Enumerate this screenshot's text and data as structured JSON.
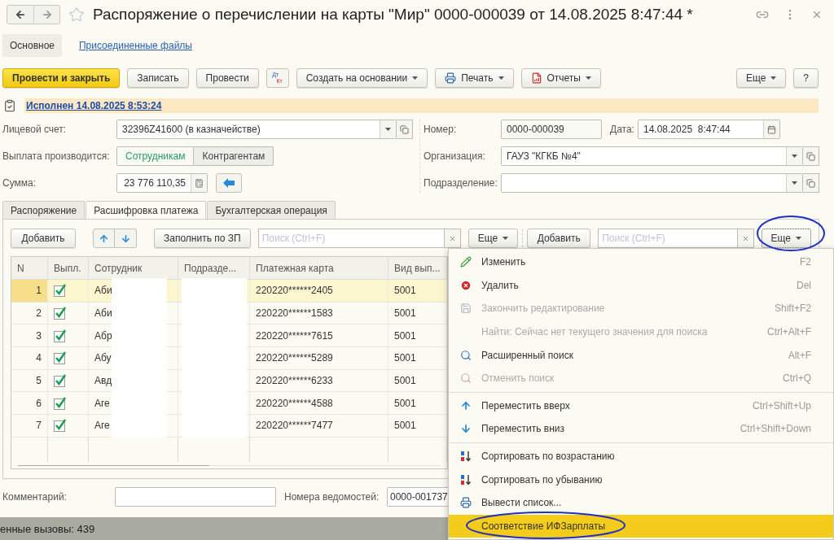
{
  "window": {
    "title": "Распоряжение о перечислении на карты \"Мир\" 0000-000039 от 14.08.2025 8:47:44 *",
    "starred": false
  },
  "form_tabs": [
    {
      "label": "Основное",
      "selected": true
    },
    {
      "label": "Присоединенные файлы",
      "selected": false
    }
  ],
  "command_bar": [
    {
      "label": "Провести и закрыть",
      "kind": "primary"
    },
    {
      "label": "Записать",
      "kind": "button"
    },
    {
      "label": "Провести",
      "kind": "button"
    },
    {
      "kind": "dtkt",
      "top": "Дт",
      "bottom": "Кт"
    },
    {
      "label": "Создать на основании",
      "kind": "dropdown"
    },
    {
      "label": "Печать",
      "kind": "print"
    },
    {
      "label": "Отчеты",
      "kind": "report"
    }
  ],
  "command_bar_right": [
    {
      "label": "Еще",
      "kind": "dropdown"
    },
    {
      "label": "?",
      "kind": "button"
    }
  ],
  "status": {
    "text": "Исполнен 14.08.2025 8:53:24"
  },
  "account": {
    "label": "Лицевой счет:",
    "value": "32396Z41600 (в казначействе)"
  },
  "payment_to": {
    "label": "Выплата производится:",
    "options": [
      {
        "label": "Сотрудникам",
        "selected": true
      },
      {
        "label": "Контрагентам",
        "selected": false
      }
    ]
  },
  "sum": {
    "label": "Сумма:",
    "value": "23 776 110,35"
  },
  "number": {
    "label": "Номер:",
    "value": "0000-000039"
  },
  "date": {
    "label": "Дата:",
    "value": "14.08.2025  8:47:44"
  },
  "organization": {
    "label": "Организация:",
    "value": "ГАУЗ \"КГКБ №4\""
  },
  "subdivision": {
    "label": "Подразделение:"
  },
  "tabs": [
    {
      "label": "Распоряжение",
      "selected": false
    },
    {
      "label": "Расшифровка платежа",
      "selected": true
    },
    {
      "label": "Бухгалтерская операция",
      "selected": false
    }
  ],
  "left_toolbar": {
    "add": "Добавить",
    "fill": "Заполнить по ЗП",
    "search_placeholder": "Поиск (Ctrl+F)",
    "more": "Еще"
  },
  "right_toolbar": {
    "add": "Добавить",
    "search_placeholder": "Поиск (Ctrl+F)",
    "more": "Еще",
    "more_circled": true
  },
  "table": {
    "columns": [
      "N",
      "Выпл.",
      "Сотрудник",
      "Подразде...",
      "Платежная карта",
      "Вид вып..."
    ],
    "rows": [
      {
        "n": "1",
        "paid": true,
        "employee": "Аби",
        "card": "220220******2405",
        "type": "5001",
        "selected": true
      },
      {
        "n": "2",
        "paid": true,
        "employee": "Аби",
        "card": "220220******1583",
        "type": "5001",
        "selected": false
      },
      {
        "n": "3",
        "paid": true,
        "employee": "Абр",
        "card": "220220******7615",
        "type": "5001",
        "selected": false
      },
      {
        "n": "4",
        "paid": true,
        "employee": "Абу",
        "card": "220220******5289",
        "type": "5001",
        "selected": false
      },
      {
        "n": "5",
        "paid": true,
        "employee": "Авд",
        "card": "220220******6233",
        "type": "5001",
        "selected": false
      },
      {
        "n": "6",
        "paid": true,
        "employee": "Аге",
        "card": "220220******4588",
        "type": "5001",
        "selected": false
      },
      {
        "n": "7",
        "paid": true,
        "employee": "Аге",
        "card": "220220******7477",
        "type": "5001",
        "selected": false
      }
    ]
  },
  "comment": {
    "label": "Комментарий:"
  },
  "statements": {
    "label": "Номера ведомостей:",
    "value": "0000-001737"
  },
  "status_bar": {
    "text": "енные вызовы: 439"
  },
  "menu": [
    {
      "kind": "edit",
      "label": "Изменить",
      "shortcut": "F2",
      "disabled": false,
      "selected": false
    },
    {
      "kind": "delete",
      "label": "Удалить",
      "shortcut": "Del",
      "disabled": false,
      "selected": false
    },
    {
      "kind": "save",
      "label": "Закончить редактирование",
      "shortcut": "Shift+F2",
      "disabled": true,
      "selected": false
    },
    {
      "kind": "plain",
      "label": "Найти: Сейчас нет текущего значения для поиска",
      "shortcut": "Ctrl+Alt+F",
      "disabled": true,
      "selected": false
    },
    {
      "kind": "search",
      "label": "Расширенный поиск",
      "shortcut": "Alt+F",
      "disabled": false,
      "selected": false
    },
    {
      "kind": "search",
      "label": "Отменить поиск",
      "shortcut": "Ctrl+Q",
      "disabled": true,
      "selected": false
    },
    {
      "kind": "separator"
    },
    {
      "kind": "move-up",
      "label": "Переместить вверх",
      "shortcut": "Ctrl+Shift+Up",
      "disabled": false,
      "selected": false
    },
    {
      "kind": "move-down",
      "label": "Переместить вниз",
      "shortcut": "Ctrl+Shift+Down",
      "disabled": false,
      "selected": false
    },
    {
      "kind": "separator"
    },
    {
      "kind": "sort",
      "label": "Сортировать по возрастанию",
      "disabled": false,
      "selected": false
    },
    {
      "kind": "sort",
      "label": "Сортировать по убыванию",
      "disabled": false,
      "selected": false
    },
    {
      "kind": "print",
      "label": "Вывести список...",
      "disabled": false,
      "selected": false
    },
    {
      "kind": "plain",
      "label": "Соответствие ИФЗарплаты",
      "disabled": false,
      "selected": true,
      "circled": true
    }
  ]
}
